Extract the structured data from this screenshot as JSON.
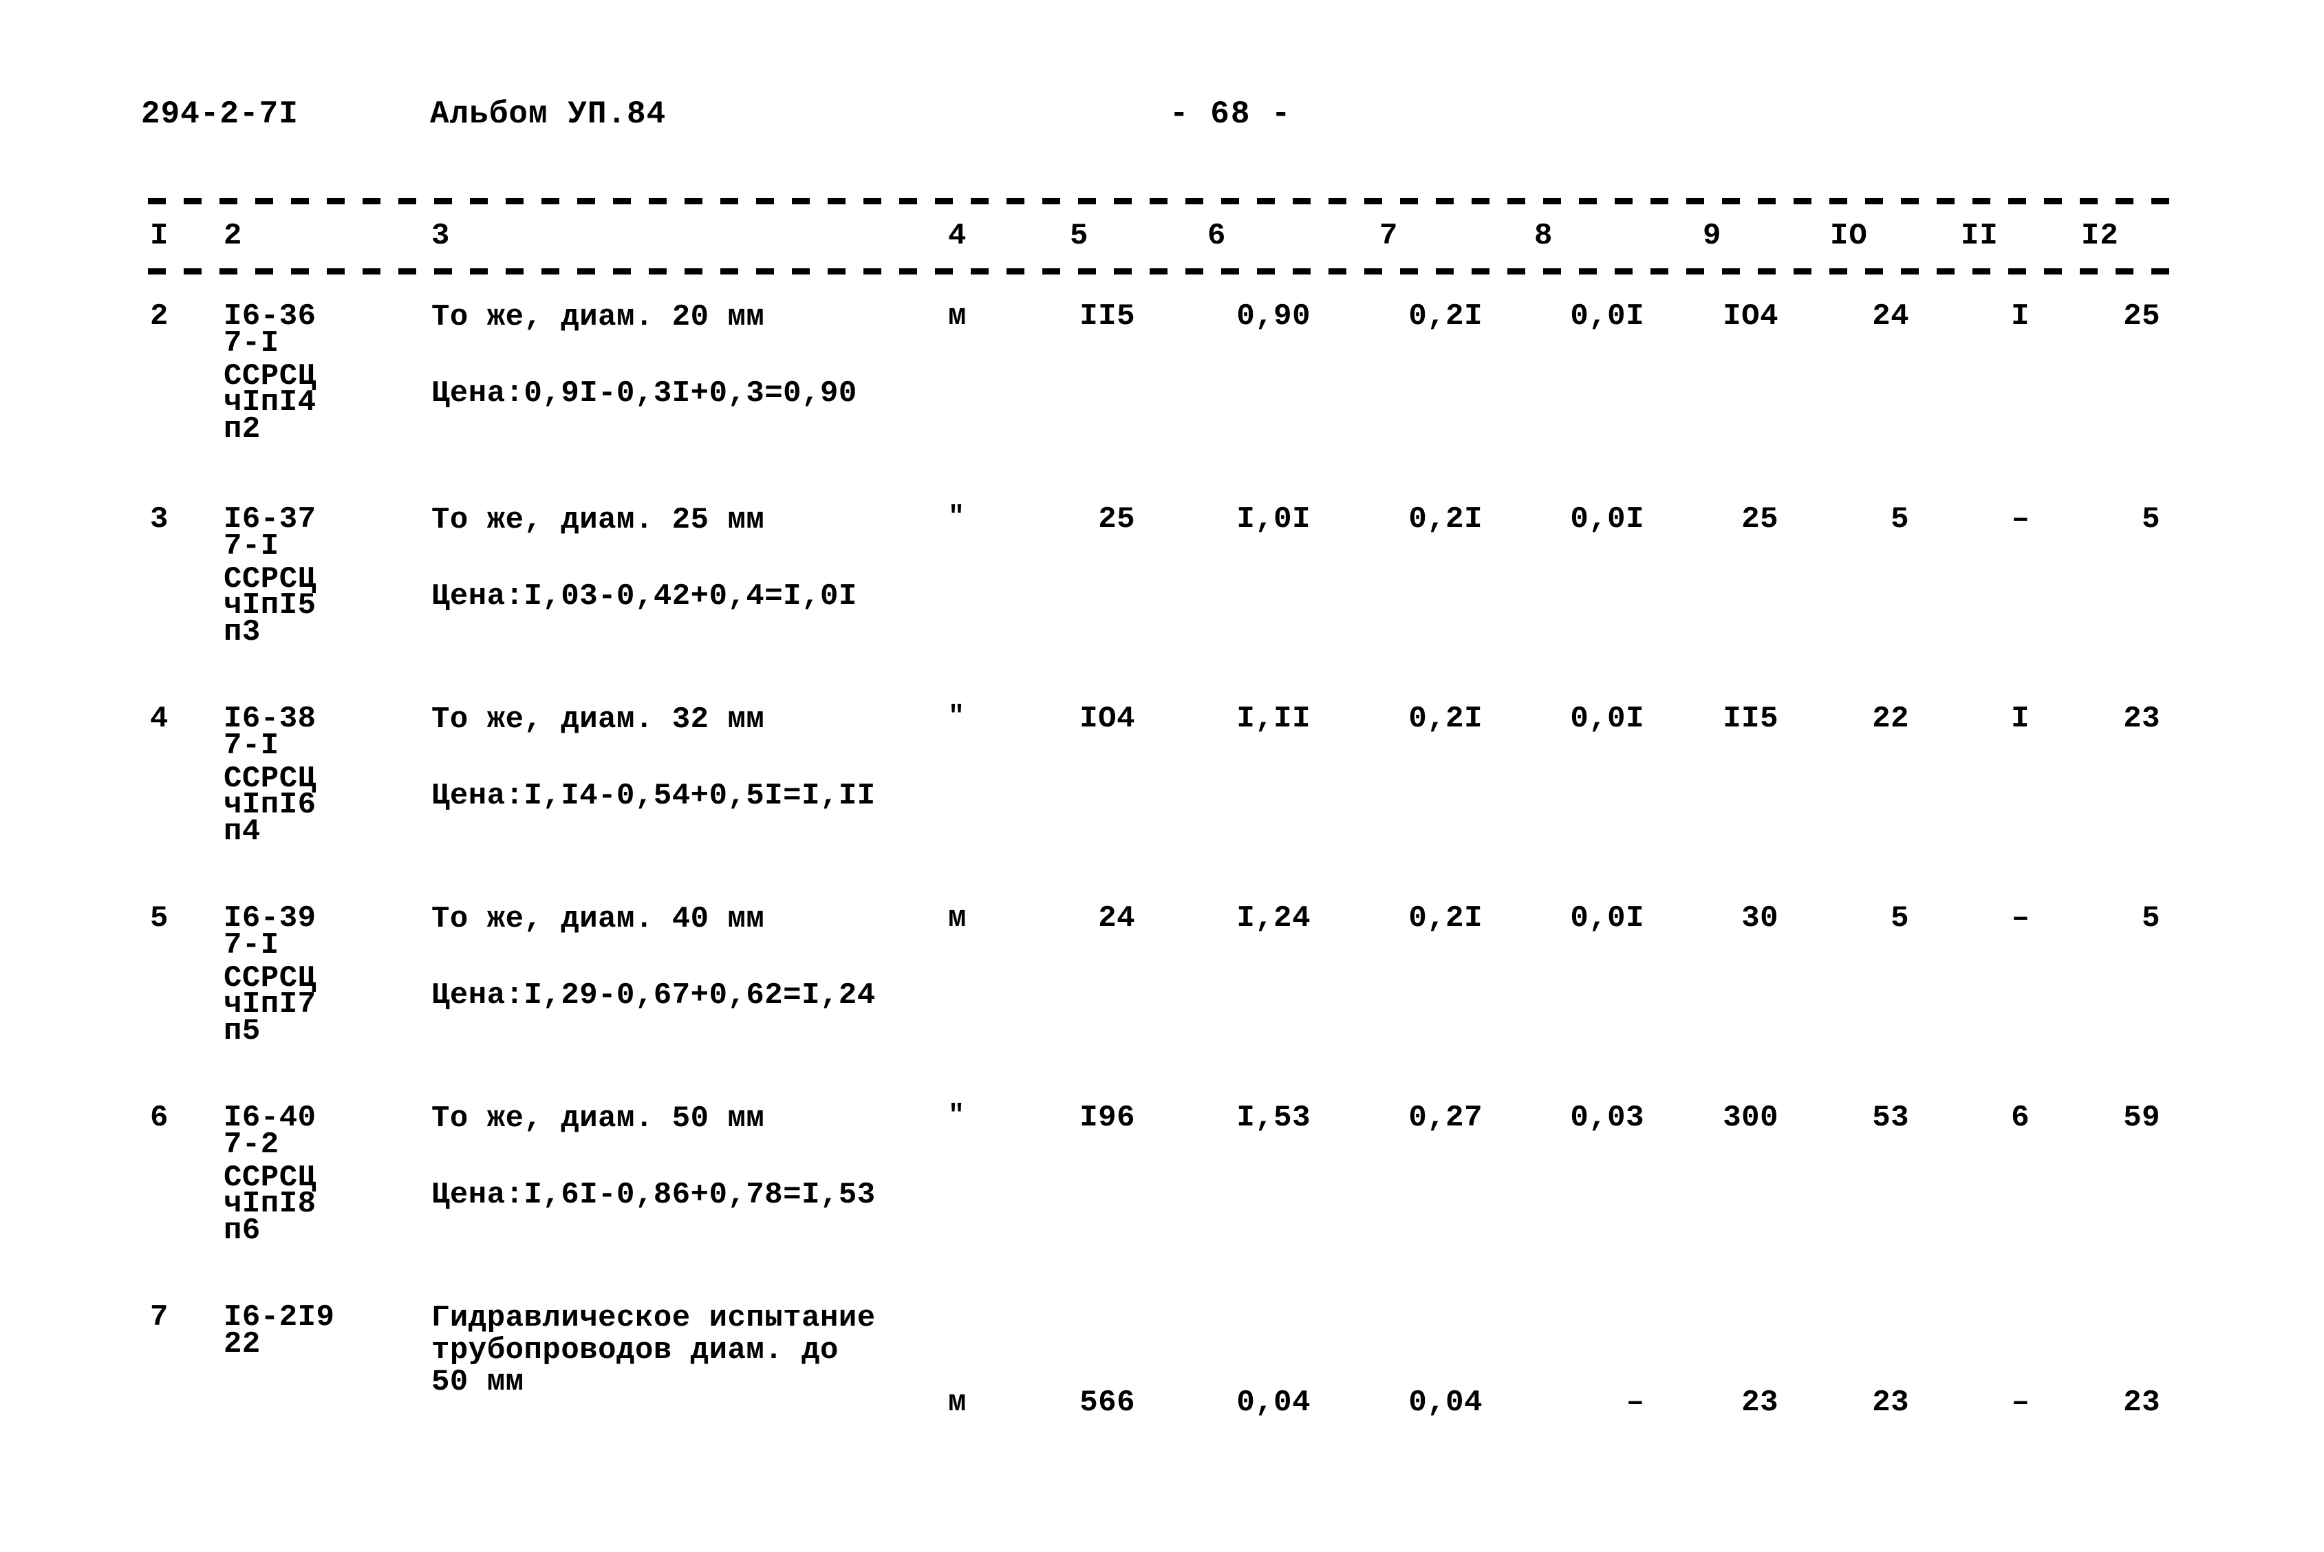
{
  "header": {
    "document_code": "294-2-7I",
    "album": "Альбом УП.84",
    "page_marker": "- 68 -"
  },
  "table": {
    "column_headers": [
      "I",
      "2",
      "3",
      "4",
      "5",
      "6",
      "7",
      "8",
      "9",
      "IO",
      "II",
      "I2"
    ],
    "rows": [
      {
        "no": "2",
        "code_lines": [
          "I6-36",
          "7-I",
          "ССРСЦ",
          "чIпI4",
          "п2"
        ],
        "description_lines": [
          "То же, диам. 20 мм"
        ],
        "price_note": "Цена:0,9I-0,3I+0,3=0,90",
        "unit": "м",
        "unit_is_ditto": false,
        "col5": "II5",
        "col6": "0,90",
        "col7": "0,2I",
        "col8": "0,0I",
        "col9": "IO4",
        "col10": "24",
        "col11": "I",
        "col12": "25"
      },
      {
        "no": "3",
        "code_lines": [
          "I6-37",
          "7-I",
          "ССРСЦ",
          "чIпI5",
          "п3"
        ],
        "description_lines": [
          "То же, диам. 25 мм"
        ],
        "price_note": "Цена:I,03-0,42+0,4=I,0I",
        "unit": "\"",
        "unit_is_ditto": true,
        "col5": "25",
        "col6": "I,0I",
        "col7": "0,2I",
        "col8": "0,0I",
        "col9": "25",
        "col10": "5",
        "col11": "–",
        "col12": "5"
      },
      {
        "no": "4",
        "code_lines": [
          "I6-38",
          "7-I",
          "ССРСЦ",
          "чIпI6",
          "п4"
        ],
        "description_lines": [
          "То же, диам. 32 мм"
        ],
        "price_note": "Цена:I,I4-0,54+0,5I=I,II",
        "unit": "\"",
        "unit_is_ditto": true,
        "col5": "IO4",
        "col6": "I,II",
        "col7": "0,2I",
        "col8": "0,0I",
        "col9": "II5",
        "col10": "22",
        "col11": "I",
        "col12": "23"
      },
      {
        "no": "5",
        "code_lines": [
          "I6-39",
          "7-I",
          "ССРСЦ",
          "чIпI7",
          "п5"
        ],
        "description_lines": [
          "То же, диам. 40 мм"
        ],
        "price_note": "Цена:I,29-0,67+0,62=I,24",
        "unit": "м",
        "unit_is_ditto": false,
        "col5": "24",
        "col6": "I,24",
        "col7": "0,2I",
        "col8": "0,0I",
        "col9": "30",
        "col10": "5",
        "col11": "–",
        "col12": "5"
      },
      {
        "no": "6",
        "code_lines": [
          "I6-40",
          "7-2",
          "ССРСЦ",
          "чIпI8",
          "п6"
        ],
        "description_lines": [
          "То же, диам. 50 мм"
        ],
        "price_note": "Цена:I,6I-0,86+0,78=I,53",
        "unit": "\"",
        "unit_is_ditto": true,
        "col5": "I96",
        "col6": "I,53",
        "col7": "0,27",
        "col8": "0,03",
        "col9": "300",
        "col10": "53",
        "col11": "6",
        "col12": "59"
      },
      {
        "no": "7",
        "code_lines": [
          "I6-2I9",
          "22"
        ],
        "description_lines": [
          "Гидравлическое испытание",
          "трубопроводов диам. до",
          "50 мм"
        ],
        "price_note": "",
        "unit": "м",
        "unit_is_ditto": false,
        "col5": "566",
        "col6": "0,04",
        "col7": "0,04",
        "col8": "–",
        "col9": "23",
        "col10": "23",
        "col11": "–",
        "col12": "23"
      }
    ]
  }
}
